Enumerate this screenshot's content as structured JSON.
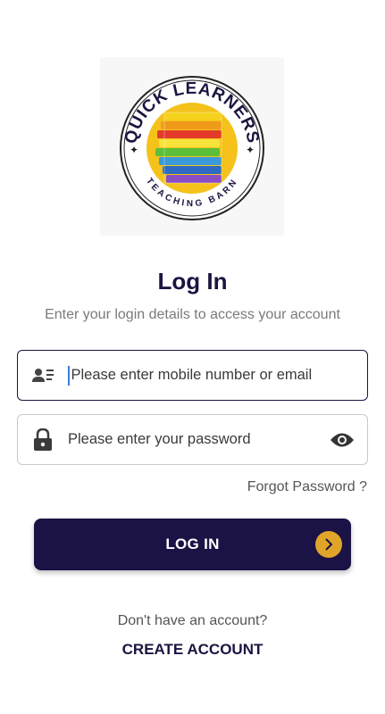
{
  "logo": {
    "text_top": "QUICK LEARNERS",
    "text_bottom": "TEACHING BARN"
  },
  "title": "Log In",
  "subtitle": "Enter your login details to access your account",
  "fields": {
    "user_placeholder": "Please enter mobile number or email",
    "password_placeholder": "Please enter your password"
  },
  "forgot_label": "Forgot Password ?",
  "login_label": "LOG IN",
  "no_account_text": "Don't have an account?",
  "create_account_label": "CREATE ACCOUNT",
  "icons": {
    "user": "contact-card-icon",
    "lock": "lock-icon",
    "eye": "eye-icon",
    "arrow": "chevron-right-icon"
  },
  "colors": {
    "primary": "#1b1245",
    "accent": "#e0a528",
    "muted": "#7a7a7a"
  }
}
